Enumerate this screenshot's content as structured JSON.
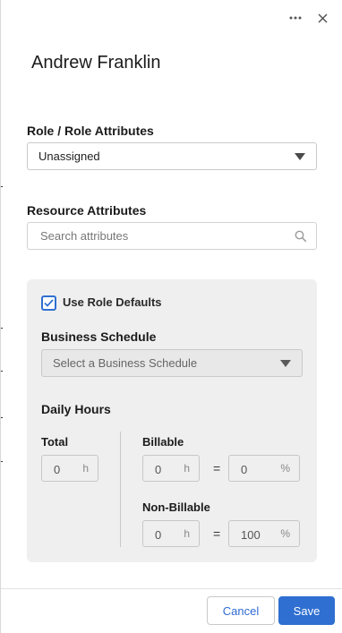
{
  "header": {
    "person_name": "Andrew Franklin",
    "more_icon": "ellipsis-icon",
    "close_icon": "close-icon"
  },
  "role": {
    "label": "Role / Role Attributes",
    "selected": "Unassigned"
  },
  "resource": {
    "label": "Resource Attributes",
    "search_placeholder": "Search attributes"
  },
  "defaults": {
    "use_role_defaults_label": "Use Role Defaults",
    "use_role_defaults_checked": true,
    "schedule_label": "Business Schedule",
    "schedule_placeholder": "Select a Business Schedule",
    "daily_hours_label": "Daily Hours",
    "total_label": "Total",
    "total_value": "0",
    "billable_label": "Billable",
    "billable_hours": "0",
    "billable_percent": "0",
    "non_billable_label": "Non-Billable",
    "non_billable_hours": "0",
    "non_billable_percent": "100",
    "hours_unit": "h",
    "percent_unit": "%",
    "equals": "="
  },
  "footer": {
    "cancel_label": "Cancel",
    "save_label": "Save"
  },
  "colors": {
    "accent": "#2f6fd1",
    "panel_bg": "#efefef"
  }
}
